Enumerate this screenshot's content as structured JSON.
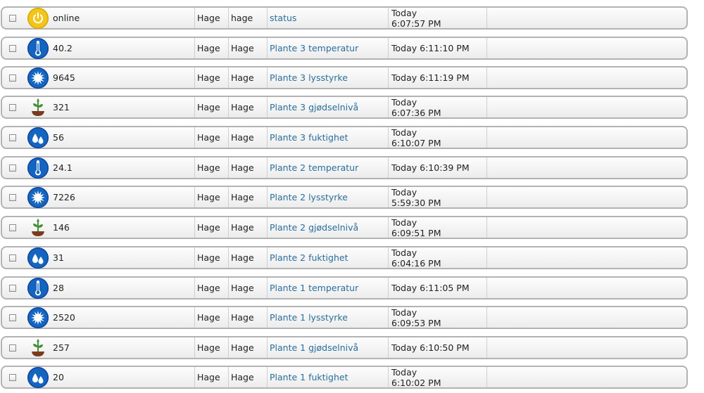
{
  "rows": [
    {
      "icon": "power-icon",
      "value": "online",
      "room": "Hage",
      "group": "hage",
      "name": "status",
      "time_line1": "Today",
      "time_line2": "6:07:57 PM"
    },
    {
      "icon": "thermometer-icon",
      "value": "40.2",
      "room": "Hage",
      "group": "Hage",
      "name": "Plante 3 temperatur",
      "time_line1": "Today 6:11:10 PM",
      "time_line2": ""
    },
    {
      "icon": "sun-icon",
      "value": "9645",
      "room": "Hage",
      "group": "Hage",
      "name": "Plante 3 lysstyrke",
      "time_line1": "Today 6:11:19 PM",
      "time_line2": ""
    },
    {
      "icon": "plant-icon",
      "value": "321",
      "room": "Hage",
      "group": "Hage",
      "name": "Plante 3 gjødselnivå",
      "time_line1": "Today",
      "time_line2": "6:07:36 PM"
    },
    {
      "icon": "water-drops-icon",
      "value": "56",
      "room": "Hage",
      "group": "Hage",
      "name": "Plante 3 fuktighet",
      "time_line1": "Today",
      "time_line2": "6:10:07 PM"
    },
    {
      "icon": "thermometer-icon",
      "value": "24.1",
      "room": "Hage",
      "group": "Hage",
      "name": "Plante 2 temperatur",
      "time_line1": "Today 6:10:39 PM",
      "time_line2": ""
    },
    {
      "icon": "sun-icon",
      "value": "7226",
      "room": "Hage",
      "group": "Hage",
      "name": "Plante 2 lysstyrke",
      "time_line1": "Today",
      "time_line2": "5:59:30 PM"
    },
    {
      "icon": "plant-icon",
      "value": "146",
      "room": "Hage",
      "group": "Hage",
      "name": "Plante 2 gjødselnivå",
      "time_line1": "Today",
      "time_line2": "6:09:51 PM"
    },
    {
      "icon": "water-drops-icon",
      "value": "31",
      "room": "Hage",
      "group": "Hage",
      "name": "Plante 2 fuktighet",
      "time_line1": "Today",
      "time_line2": "6:04:16 PM"
    },
    {
      "icon": "thermometer-icon",
      "value": "28",
      "room": "Hage",
      "group": "Hage",
      "name": "Plante 1 temperatur",
      "time_line1": "Today 6:11:05 PM",
      "time_line2": ""
    },
    {
      "icon": "sun-icon",
      "value": "2520",
      "room": "Hage",
      "group": "Hage",
      "name": "Plante 1 lysstyrke",
      "time_line1": "Today",
      "time_line2": "6:09:53 PM"
    },
    {
      "icon": "plant-icon",
      "value": "257",
      "room": "Hage",
      "group": "Hage",
      "name": "Plante 1 gjødselnivå",
      "time_line1": "Today 6:10:50 PM",
      "time_line2": ""
    },
    {
      "icon": "water-drops-icon",
      "value": "20",
      "room": "Hage",
      "group": "Hage",
      "name": "Plante 1 fuktighet",
      "time_line1": "Today",
      "time_line2": "6:10:02 PM"
    }
  ],
  "colors": {
    "icon_blue": "#1565c0",
    "icon_yellow": "#f3c51b",
    "link": "#2a6f9b"
  }
}
